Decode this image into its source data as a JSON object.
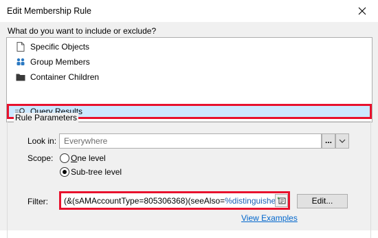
{
  "window": {
    "title": "Edit Membership Rule"
  },
  "prompt": "What do you want to include or exclude?",
  "list": {
    "items": [
      {
        "label": "Specific Objects",
        "icon": "document-icon"
      },
      {
        "label": "Group Members",
        "icon": "group-members-icon"
      },
      {
        "label": "Container Children",
        "icon": "folder-icon"
      },
      {
        "label": "Query Results",
        "icon": "query-icon",
        "selected": true
      }
    ]
  },
  "rule_parameters": {
    "group_label": "Rule Parameters",
    "look_in_label": "Look in:",
    "look_in_value": "Everywhere",
    "browse_label": "...",
    "scope_label": "Scope:",
    "scope_options": [
      {
        "label": "One level",
        "access_key": "O",
        "checked": false
      },
      {
        "label": "Sub-tree level",
        "access_key": "",
        "checked": true
      }
    ],
    "filter_label": "Filter:",
    "filter_text": "(&(sAMAccountType=805306368)(seeAlso=",
    "filter_variable": "%distinguishedNar",
    "edit_label": "Edit...",
    "view_examples_label": "View Examples"
  },
  "colors": {
    "highlight_border": "#e8112d",
    "selection": "#cce8ff",
    "link": "#0066cc"
  }
}
